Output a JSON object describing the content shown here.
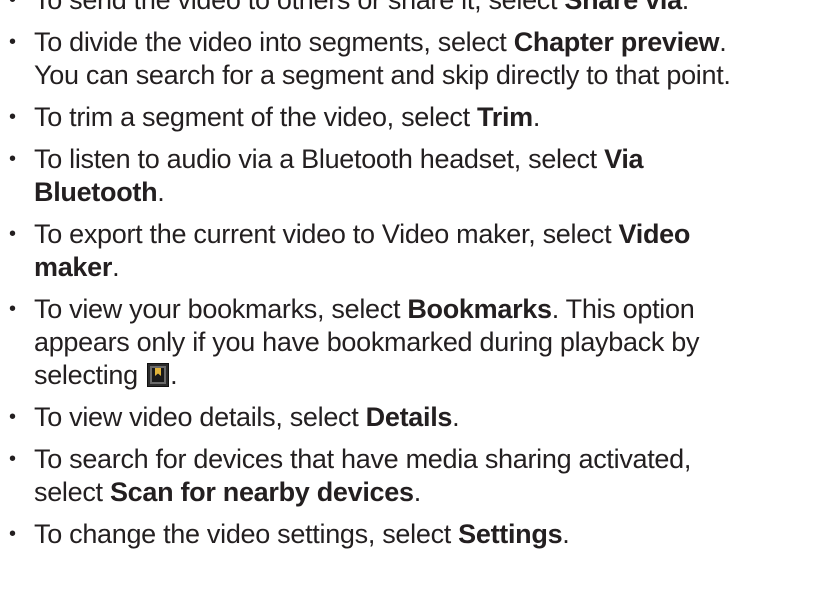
{
  "items": [
    {
      "pre": "To send the video to others or share it, select ",
      "bold": "Share via",
      "post": "."
    },
    {
      "pre": "To divide the video into segments, select ",
      "bold": "Chapter preview",
      "post": ".",
      "line2": "You can search for a segment and skip directly to that point."
    },
    {
      "pre": "To trim a segment of the video, select ",
      "bold": "Trim",
      "post": "."
    },
    {
      "pre": "To listen to audio via a Bluetooth headset, select ",
      "bold": "Via",
      "bold2": "Bluetooth",
      "post": "."
    },
    {
      "pre": "To export the current video to Video maker, select ",
      "bold": "Video",
      "bold2": "maker",
      "post": "."
    },
    {
      "pre": "To view your bookmarks, select ",
      "bold": "Bookmarks",
      "post": ". This option",
      "line2": "appears only if you have bookmarked during playback by",
      "line3": "selecting",
      "line3_post": "."
    },
    {
      "pre": "To view video details, select ",
      "bold": "Details",
      "post": "."
    },
    {
      "pre": "To search for devices that have media sharing activated,",
      "pre2": "select ",
      "bold": "Scan for nearby devices",
      "post": "."
    },
    {
      "pre": "To change the video settings, select ",
      "bold": "Settings",
      "post": "."
    }
  ],
  "bullet": "•",
  "icons": {
    "bookmark": "bookmark-icon"
  }
}
